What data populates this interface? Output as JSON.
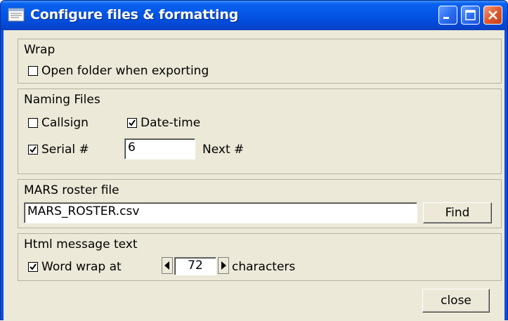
{
  "window": {
    "title": "Configure files & formatting",
    "controls": {
      "minimize": "minimize-icon",
      "maximize": "maximize-icon",
      "close": "close-icon"
    }
  },
  "wrap": {
    "title": "Wrap",
    "open_folder": {
      "label": "Open folder when exporting",
      "checked": false
    }
  },
  "naming": {
    "title": "Naming Files",
    "callsign": {
      "label": "Callsign",
      "checked": false
    },
    "datetime": {
      "label": "Date-time",
      "checked": true
    },
    "serial": {
      "label": "Serial #",
      "checked": true
    },
    "next_value": "6",
    "next_label": "Next #"
  },
  "roster": {
    "title": "MARS roster file",
    "file_value": "MARS_ROSTER.csv",
    "find_label": "Find"
  },
  "html": {
    "title": "Html message text",
    "wordwrap": {
      "label": "Word wrap at",
      "checked": true
    },
    "width_value": "72",
    "units_label": "characters"
  },
  "footer": {
    "close_label": "close"
  },
  "colors": {
    "titlebar": "#0456e6",
    "client": "#ece9d8",
    "close_button": "#e0592f"
  }
}
